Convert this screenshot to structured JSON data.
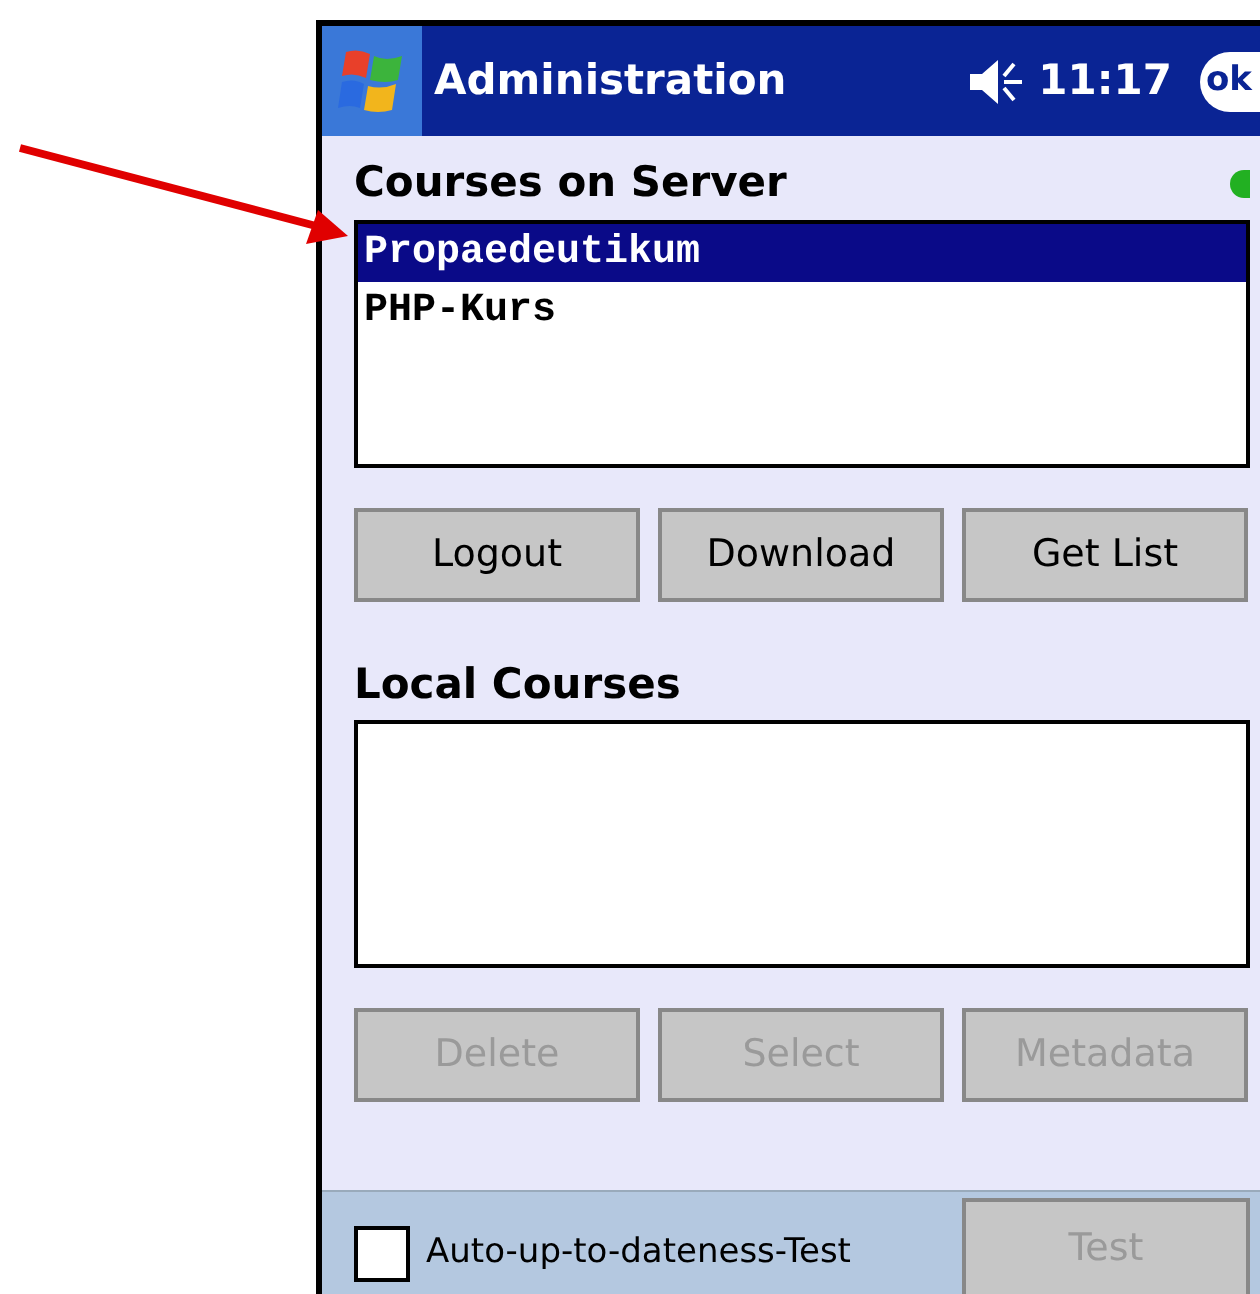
{
  "title_bar": {
    "title": "Administration",
    "time": "11:17",
    "ok": "ok"
  },
  "server": {
    "label": "Courses on Server",
    "courses": [
      {
        "name": "Propaedeutikum",
        "selected": true
      },
      {
        "name": "PHP-Kurs",
        "selected": false
      }
    ],
    "buttons": [
      {
        "label": "Logout",
        "disabled": false
      },
      {
        "label": "Download",
        "disabled": false
      },
      {
        "label": "Get List",
        "disabled": false
      }
    ]
  },
  "local": {
    "label": "Local Courses",
    "buttons": [
      {
        "label": "Delete",
        "disabled": true
      },
      {
        "label": "Select",
        "disabled": true
      },
      {
        "label": "Metadata",
        "disabled": true
      }
    ]
  },
  "bottom_bar": {
    "checkbox": {
      "label": "Auto-up-to-dateness-Test",
      "checked": false
    },
    "test_button": {
      "label": "Test",
      "disabled": true
    }
  }
}
